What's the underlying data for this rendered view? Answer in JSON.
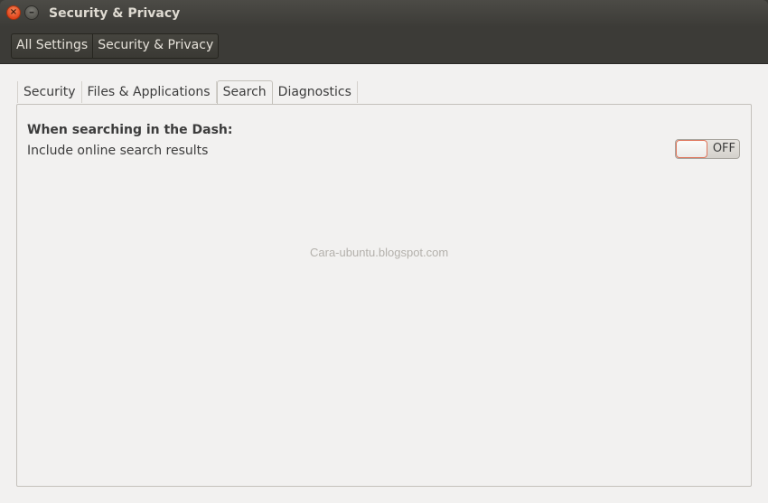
{
  "window": {
    "title": "Security & Privacy",
    "buttons": {
      "close_glyph": "×",
      "minimize_glyph": "–"
    }
  },
  "toolbar": {
    "breadcrumbs": [
      {
        "label": "All Settings"
      },
      {
        "label": "Security & Privacy"
      }
    ]
  },
  "tabs": [
    {
      "label": "Security",
      "active": false
    },
    {
      "label": "Files & Applications",
      "active": false
    },
    {
      "label": "Search",
      "active": true
    },
    {
      "label": "Diagnostics",
      "active": false
    }
  ],
  "search_panel": {
    "heading": "When searching in the Dash:",
    "option_label": "Include online search results",
    "switch": {
      "state_label": "OFF",
      "on": false
    }
  },
  "watermark": "Cara-ubuntu.blogspot.com",
  "colors": {
    "titlebar": "#3c3b37",
    "content_bg": "#f2f1f0",
    "accent_close": "#e0451c",
    "switch_knob_border": "#e0765c"
  }
}
